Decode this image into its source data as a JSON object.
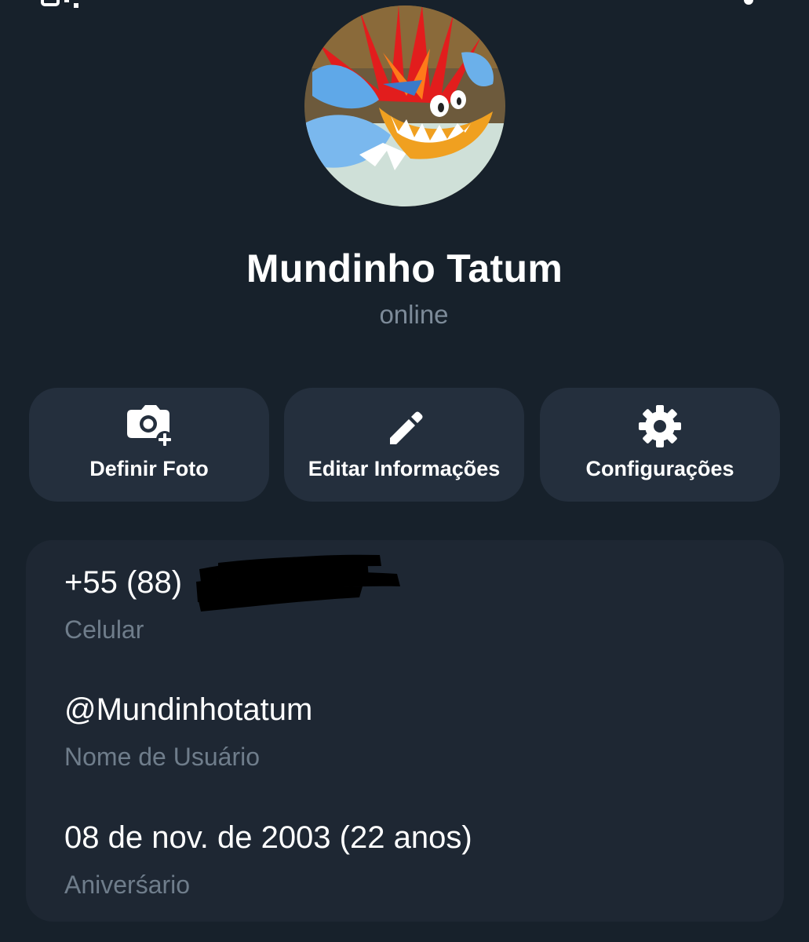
{
  "profile": {
    "name": "Mundinho Tatum",
    "status": "online",
    "avatar_icon": "cartoon-profile-photo"
  },
  "actions": [
    {
      "label": "Definir Foto",
      "icon": "camera-add-icon"
    },
    {
      "label": "Editar Informações",
      "icon": "pencil-icon"
    },
    {
      "label": "Configurações",
      "icon": "gear-icon"
    }
  ],
  "info": {
    "phone": {
      "value": "+55 (88)",
      "label": "Celular"
    },
    "username": {
      "value": "@Mundinhotatum",
      "label": "Nome de Usuário"
    },
    "birthday": {
      "value": "08 de nov. de 2003 (22 anos)",
      "label": "Aniverśario"
    }
  },
  "colors": {
    "background": "#17212b",
    "button_bg": "#242f3d",
    "card_bg": "#1e2733",
    "primary_text": "#ffffff",
    "secondary_text": "#7d8b99"
  }
}
